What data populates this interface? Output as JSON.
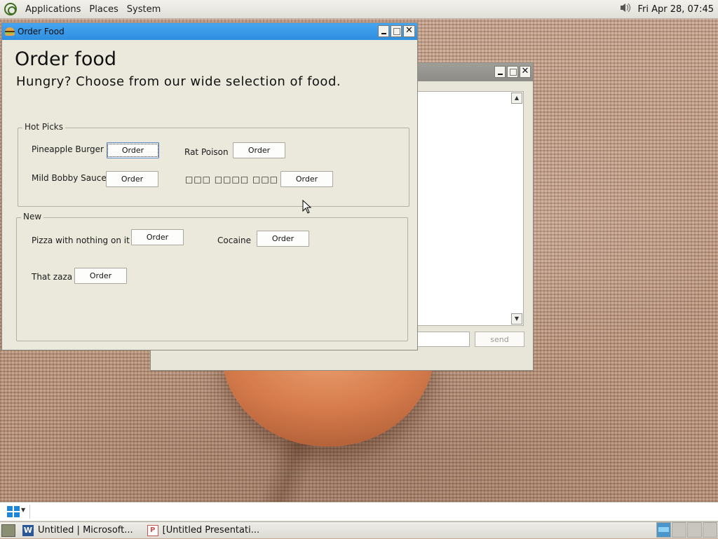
{
  "top_panel": {
    "menus": [
      "Applications",
      "Places",
      "System"
    ],
    "clock": "Fri Apr 28, 07:45"
  },
  "order_window": {
    "title": "Order Food",
    "heading": "Order food",
    "subheading": "Hungry? Choose from our wide selection of food.",
    "hot_picks": {
      "label": "Hot Picks",
      "items": [
        {
          "name": "Pineapple Burger",
          "button": "Order"
        },
        {
          "name": "Rat Poison",
          "button": "Order"
        },
        {
          "name": "Mild Bobby Sauce",
          "button": "Order"
        },
        {
          "name": "□□□ □□□□ □□□",
          "button": "Order"
        }
      ]
    },
    "new": {
      "label": "New",
      "items": [
        {
          "name": "Pizza with nothing on it",
          "button": "Order"
        },
        {
          "name": "Cocaine",
          "button": "Order"
        },
        {
          "name": "That zaza",
          "button": "Order"
        }
      ]
    }
  },
  "chat_window": {
    "send_label": "send"
  },
  "taskbar": {
    "tasks": [
      {
        "label": "Untitled | Microsoft...",
        "icon": "word-icon"
      },
      {
        "label": "[Untitled Presentati...",
        "icon": "presentation-icon"
      }
    ]
  },
  "colors": {
    "titlebar_active": "#2f8ee0",
    "window_bg": "#ebe9dc",
    "workspace_active": "#4a95c9"
  }
}
